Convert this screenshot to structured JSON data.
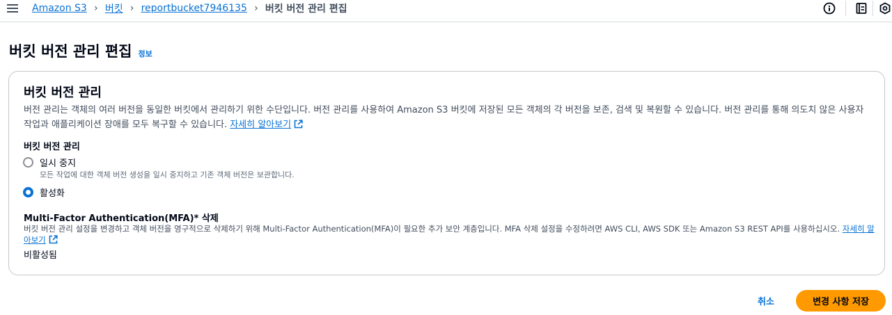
{
  "breadcrumb": {
    "items": [
      "Amazon S3",
      "버킷",
      "reportbucket7946135"
    ],
    "current": "버킷 버전 관리 편집"
  },
  "header": {
    "title": "버킷 버전 관리 편집",
    "info_link": "정보"
  },
  "versioning": {
    "title": "버킷 버전 관리",
    "description": "버전 관리는 객체의 여러 버전을 동일한 버킷에서 관리하기 위한 수단입니다. 버전 관리를 사용하여 Amazon S3 버킷에 저장된 모든 객체의 각 버전을 보존, 검색 및 복원할 수 있습니다. 버전 관리를 통해 의도치 않은 사용자 작업과 애플리케이션 장애를 모두 복구할 수 있습니다.",
    "learn_more": "자세히 알아보기",
    "field_label": "버킷 버전 관리",
    "options": [
      {
        "label": "일시 중지",
        "description": "모든 작업에 대한 객체 버전 생성을 일시 중지하고 기존 객체 버전은 보관합니다.",
        "selected": false
      },
      {
        "label": "활성화",
        "selected": true
      }
    ]
  },
  "mfa": {
    "title": "Multi-Factor Authentication(MFA)* 삭제",
    "description": "버킷 버전 관리 설정을 변경하고 객체 버전을 영구적으로 삭제하기 위해 Multi-Factor Authentication(MFA)이 필요한 추가 보안 계층입니다. MFA 삭제 설정을 수정하려면 AWS CLI, AWS SDK 또는 Amazon S3 REST API를 사용하십시오.",
    "learn_more": "자세히 알아보기",
    "status": "비활성됨"
  },
  "footer": {
    "cancel_label": "취소",
    "save_label": "변경 사항 저장"
  },
  "colors": {
    "link": "#0972d3",
    "primary_button": "#ff9900",
    "border": "#c6c6cd"
  },
  "icons": [
    "menu-icon",
    "info-icon",
    "document-icon",
    "settings-icon",
    "external-link-icon"
  ]
}
